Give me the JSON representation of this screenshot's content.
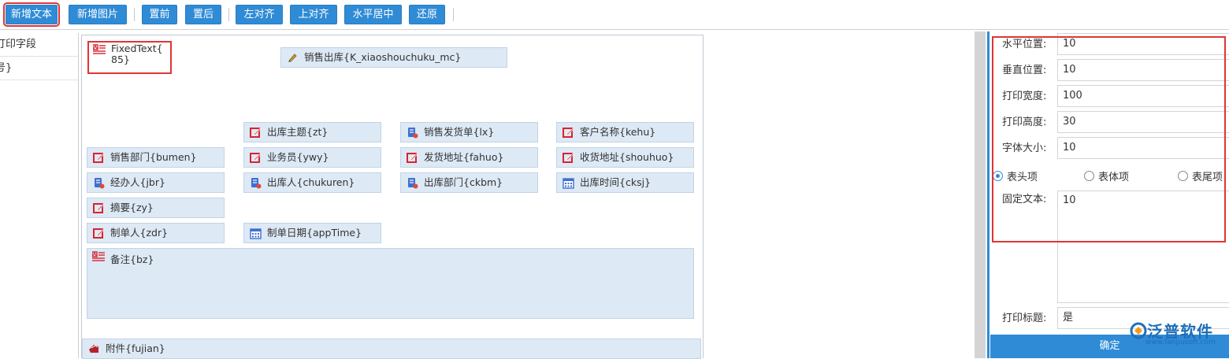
{
  "toolbar": {
    "buttons": [
      "新增文本",
      "新增图片",
      "置前",
      "置后",
      "左对齐",
      "上对齐",
      "水平居中",
      "还原"
    ]
  },
  "left_list": {
    "items": [
      "打印字段",
      "号}"
    ]
  },
  "canvas": {
    "fixed_text": "FixedText{ 85}",
    "fields": {
      "sales_out": "销售出库{K_xiaoshouchuku_mc}",
      "out_subject": "出库主题{zt}",
      "sales_invoice": "销售发货单{lx}",
      "customer_name": "客户名称{kehu}",
      "sales_dept": "销售部门{bumen}",
      "salesman": "业务员{ywy}",
      "ship_address": "发货地址{fahuo}",
      "receive_address": "收货地址{shouhuo}",
      "handler": "经办人{jbr}",
      "out_person": "出库人{chukuren}",
      "out_dept": "出库部门{ckbm}",
      "out_time": "出库时间{cksj}",
      "summary": "摘要{zy}",
      "creator": "制单人{zdr}",
      "create_date": "制单日期{appTime}",
      "remark": "备注{bz}",
      "attachment": "附件{fujian}"
    }
  },
  "props": {
    "h_pos_label": "水平位置:",
    "h_pos_value": "10",
    "v_pos_label": "垂直位置:",
    "v_pos_value": "10",
    "width_label": "打印宽度:",
    "width_value": "100",
    "height_label": "打印高度:",
    "height_value": "30",
    "font_label": "字体大小:",
    "font_value": "10",
    "radio_header": "表头项",
    "radio_body": "表体项",
    "radio_footer": "表尾项",
    "radio_selected": "表头项",
    "fixed_label": "固定文本:",
    "fixed_value": "10",
    "title_label": "打印标题:",
    "title_value": "是",
    "confirm": "确定"
  },
  "logo": {
    "name": "泛普软件",
    "url": "www.fanpusoft.com"
  },
  "colors": {
    "accent": "#2f8bd6",
    "highlight": "#e03535",
    "field_bg": "#dde9f5",
    "icon_red": "#d9232e",
    "icon_blue": "#3f6fd1"
  },
  "icons": {
    "text": "text-icon",
    "pencil": "pencil-icon",
    "edit": "edit-icon",
    "user": "user-icon",
    "calendar": "calendar-icon",
    "attachment": "attachment-icon"
  }
}
